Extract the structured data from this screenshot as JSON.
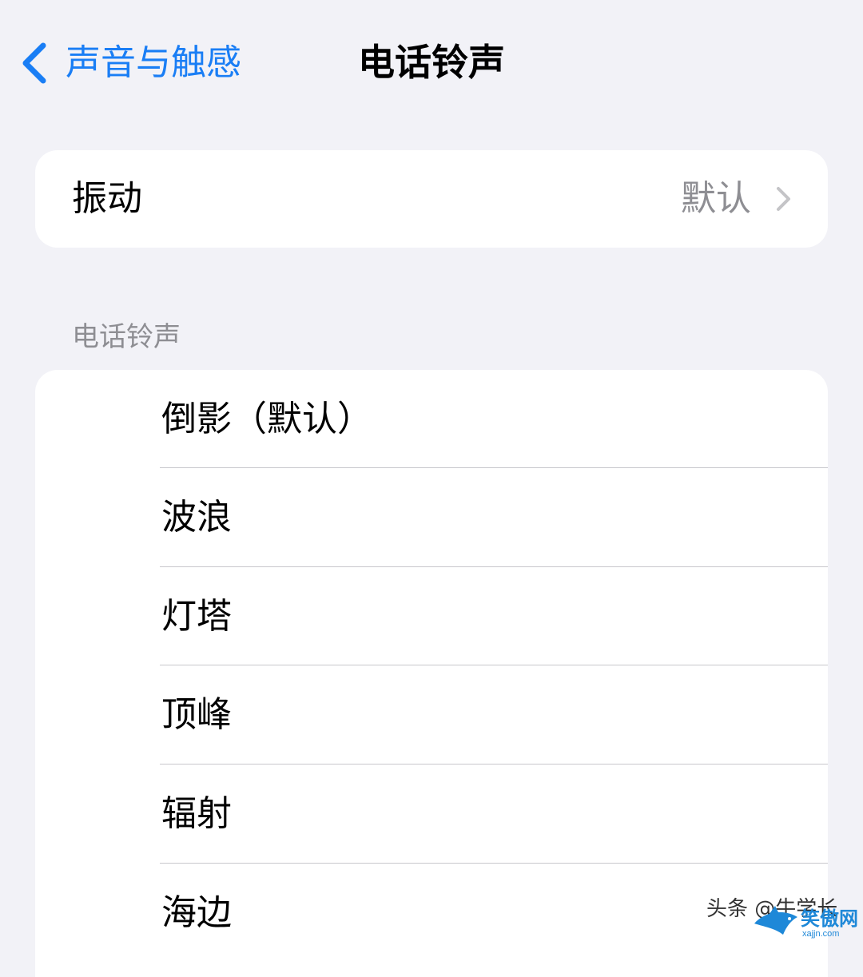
{
  "nav": {
    "back_label": "声音与触感",
    "title": "电话铃声"
  },
  "vibration": {
    "label": "振动",
    "value": "默认"
  },
  "ringtones": {
    "header": "电话铃声",
    "items": [
      {
        "label": "倒影（默认）"
      },
      {
        "label": "波浪"
      },
      {
        "label": "灯塔"
      },
      {
        "label": "顶峰"
      },
      {
        "label": "辐射"
      },
      {
        "label": "海边"
      }
    ]
  },
  "watermark": {
    "text": "头条 @牛学长",
    "logo_text": "笑傲网",
    "logo_url_text": "xajjn.com"
  },
  "colors": {
    "accent": "#1a7ef5",
    "background": "#f2f2f7",
    "secondary_text": "#8e8e93"
  }
}
